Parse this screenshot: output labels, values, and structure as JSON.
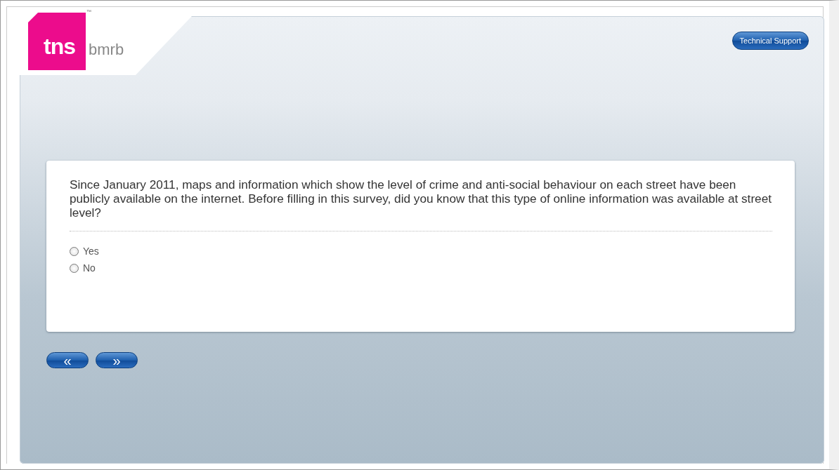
{
  "logo": {
    "mark": "tns",
    "word": "bmrb",
    "trademark": "™"
  },
  "header": {
    "support_button": "Technical Support"
  },
  "question": {
    "text": "Since January 2011, maps and information which show the level of crime and anti-social behaviour on each street have been publicly available on the internet. Before filling in this survey, did you know that this type of online information was available at street level?",
    "options": [
      {
        "label": "Yes",
        "selected": false
      },
      {
        "label": "No",
        "selected": false
      }
    ]
  },
  "navigation": {
    "back": "«",
    "next": "»"
  }
}
